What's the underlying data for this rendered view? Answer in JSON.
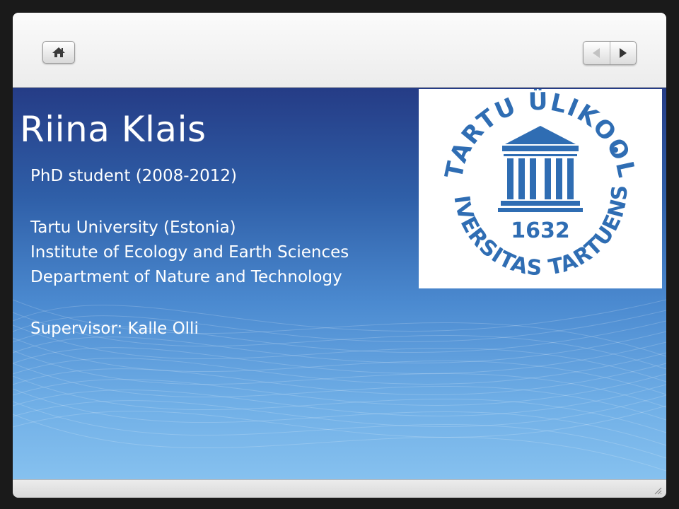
{
  "toolbar": {
    "home_icon": "home-icon",
    "prev_icon": "triangle-left-icon",
    "next_icon": "triangle-right-icon"
  },
  "slide": {
    "title": "Riina Klais",
    "lines": [
      "PhD student (2008-2012)",
      "Tartu University (Estonia)",
      "Institute of Ecology and Earth Sciences",
      "Department of Nature and Technology",
      "Supervisor: Kalle Olli"
    ]
  },
  "logo": {
    "top_text": "TARTU ÜLIKOOL",
    "bottom_text": "UNIVERSITAS TARTUENSIS",
    "year": "1632",
    "color": "#2f6db3"
  },
  "colors": {
    "background_top": "#253c86",
    "background_bottom": "#86c1ef",
    "text": "#ffffff"
  }
}
